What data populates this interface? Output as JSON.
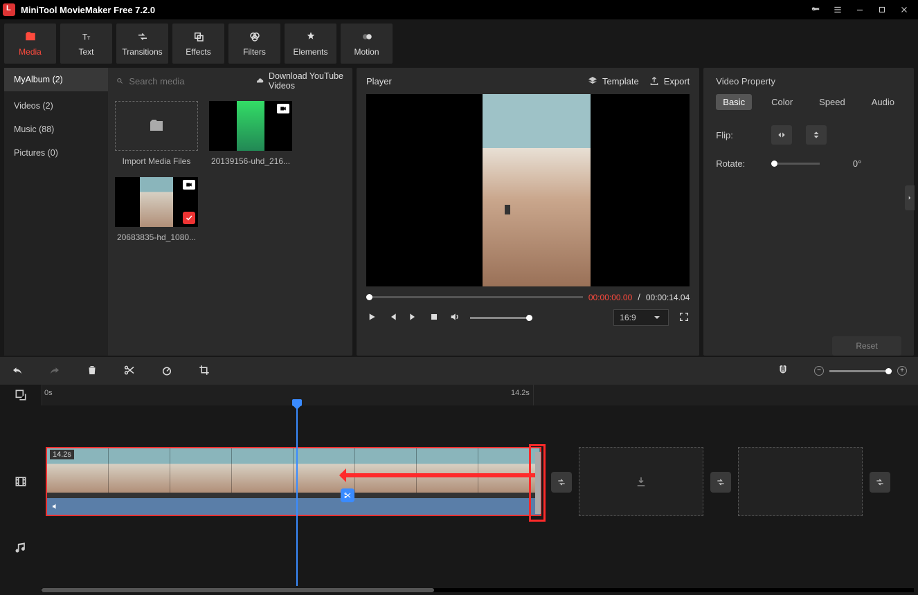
{
  "app": {
    "title": "MiniTool MovieMaker Free 7.2.0"
  },
  "toolstrip": [
    {
      "label": "Media",
      "icon": "folder",
      "active": true
    },
    {
      "label": "Text",
      "icon": "text",
      "active": false
    },
    {
      "label": "Transitions",
      "icon": "transition",
      "active": false
    },
    {
      "label": "Effects",
      "icon": "effects",
      "active": false
    },
    {
      "label": "Filters",
      "icon": "filters",
      "active": false
    },
    {
      "label": "Elements",
      "icon": "elements",
      "active": false
    },
    {
      "label": "Motion",
      "icon": "motion",
      "active": false
    }
  ],
  "sidebar": [
    {
      "label": "MyAlbum (2)",
      "active": true
    },
    {
      "label": "Videos (2)",
      "active": false
    },
    {
      "label": "Music (88)",
      "active": false
    },
    {
      "label": "Pictures (0)",
      "active": false
    }
  ],
  "search": {
    "placeholder": "Search media"
  },
  "download_link": "Download YouTube Videos",
  "media": {
    "import_label": "Import Media Files",
    "items": [
      {
        "name": "20139156-uhd_216...",
        "kind": "video",
        "selected": false
      },
      {
        "name": "20683835-hd_1080...",
        "kind": "video",
        "selected": true
      }
    ]
  },
  "player": {
    "title": "Player",
    "template_label": "Template",
    "export_label": "Export",
    "current_time": "00:00:00.00",
    "duration": "00:00:14.04",
    "ratio": "16:9"
  },
  "property": {
    "title": "Video Property",
    "tabs": [
      {
        "label": "Basic",
        "active": true
      },
      {
        "label": "Color",
        "active": false
      },
      {
        "label": "Speed",
        "active": false
      },
      {
        "label": "Audio",
        "active": false
      }
    ],
    "flip_label": "Flip:",
    "rotate_label": "Rotate:",
    "rotate_value": "0°",
    "reset_label": "Reset"
  },
  "timeline": {
    "ticks": [
      {
        "pos": 0,
        "label": "0s"
      },
      {
        "pos": 710,
        "label": "14.2s"
      }
    ],
    "clip_duration": "14.2s"
  }
}
